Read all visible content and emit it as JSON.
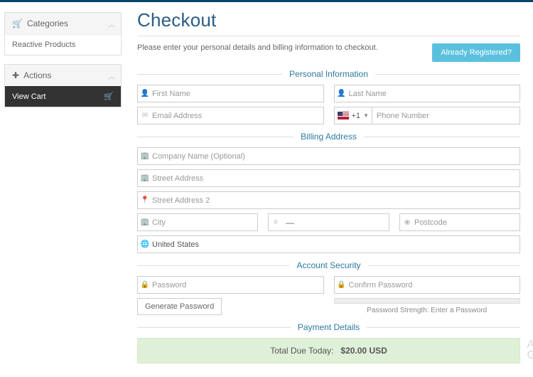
{
  "sidebar": {
    "categories": {
      "title": "Categories",
      "item": "Reactive Products"
    },
    "actions": {
      "title": "Actions",
      "view_cart": "View Cart"
    }
  },
  "checkout": {
    "title": "Checkout",
    "intro": "Please enter your personal details and billing information to checkout.",
    "already_registered": "Already Registered?"
  },
  "sections": {
    "personal": "Personal Information",
    "billing": "Billing Address",
    "security": "Account Security",
    "payment": "Payment Details"
  },
  "placeholders": {
    "first_name": "First Name",
    "last_name": "Last Name",
    "email": "Email Address",
    "phone": "Phone Number",
    "company": "Company Name (Optional)",
    "street1": "Street Address",
    "street2": "Street Address 2",
    "city": "City",
    "postcode": "Postcode",
    "password": "Password",
    "confirm": "Confirm Password"
  },
  "values": {
    "dial_code": "+1",
    "state_placeholder": "—",
    "country": "United States"
  },
  "buttons": {
    "generate_password": "Generate Password"
  },
  "strength": {
    "label": "Password Strength: Enter a Password"
  },
  "total": {
    "label": "Total Due Today:  ",
    "amount": "$20.00 USD"
  }
}
